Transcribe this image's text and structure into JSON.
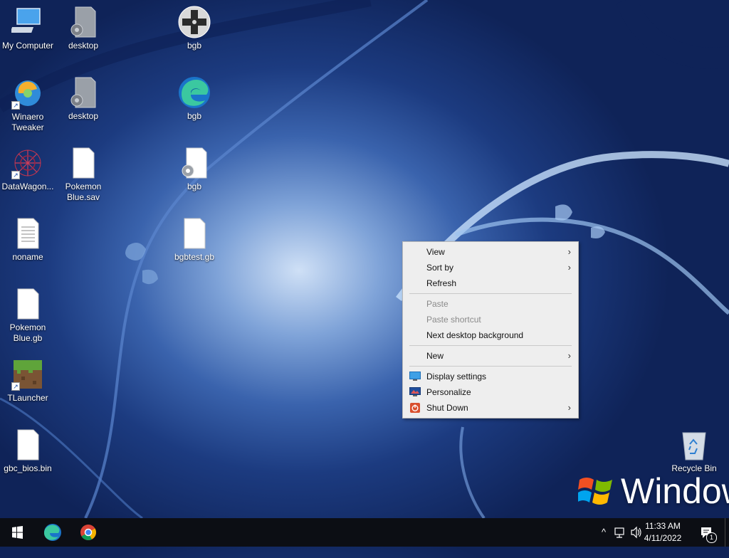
{
  "desktop": {
    "icons": [
      {
        "label": "My Computer"
      },
      {
        "label": "desktop"
      },
      {
        "label": "bgb"
      },
      {
        "label": "Winaero Tweaker"
      },
      {
        "label": "desktop"
      },
      {
        "label": "bgb"
      },
      {
        "label": "DataWagon..."
      },
      {
        "label": "Pokemon Blue.sav"
      },
      {
        "label": "bgb"
      },
      {
        "label": "noname"
      },
      {
        "label": "bgbtest.gb"
      },
      {
        "label": "Pokemon Blue.gb"
      },
      {
        "label": "TLauncher"
      },
      {
        "label": "gbc_bios.bin"
      },
      {
        "label": "Recycle Bin"
      }
    ],
    "wallpaper_text": "Windows"
  },
  "context_menu": {
    "items": [
      {
        "label": "View",
        "has_submenu": true
      },
      {
        "label": "Sort by",
        "has_submenu": true
      },
      {
        "label": "Refresh"
      },
      {
        "label": "Paste",
        "disabled": true
      },
      {
        "label": "Paste shortcut",
        "disabled": true
      },
      {
        "label": "Next desktop background"
      },
      {
        "label": "New",
        "has_submenu": true
      },
      {
        "label": "Display settings",
        "icon": "display-icon"
      },
      {
        "label": "Personalize",
        "icon": "personalize-icon"
      },
      {
        "label": "Shut Down",
        "icon": "power-icon",
        "has_submenu": true
      }
    ],
    "arrow_glyph": "›"
  },
  "taskbar": {
    "clock_time": "11:33 AM",
    "clock_date": "4/11/2022",
    "notification_count": "1",
    "tray_chevron": "^"
  },
  "colors": {
    "taskbar_bg": "#0c0e14",
    "menu_bg": "#eeeeee",
    "accent_blue": "#0078d7"
  }
}
